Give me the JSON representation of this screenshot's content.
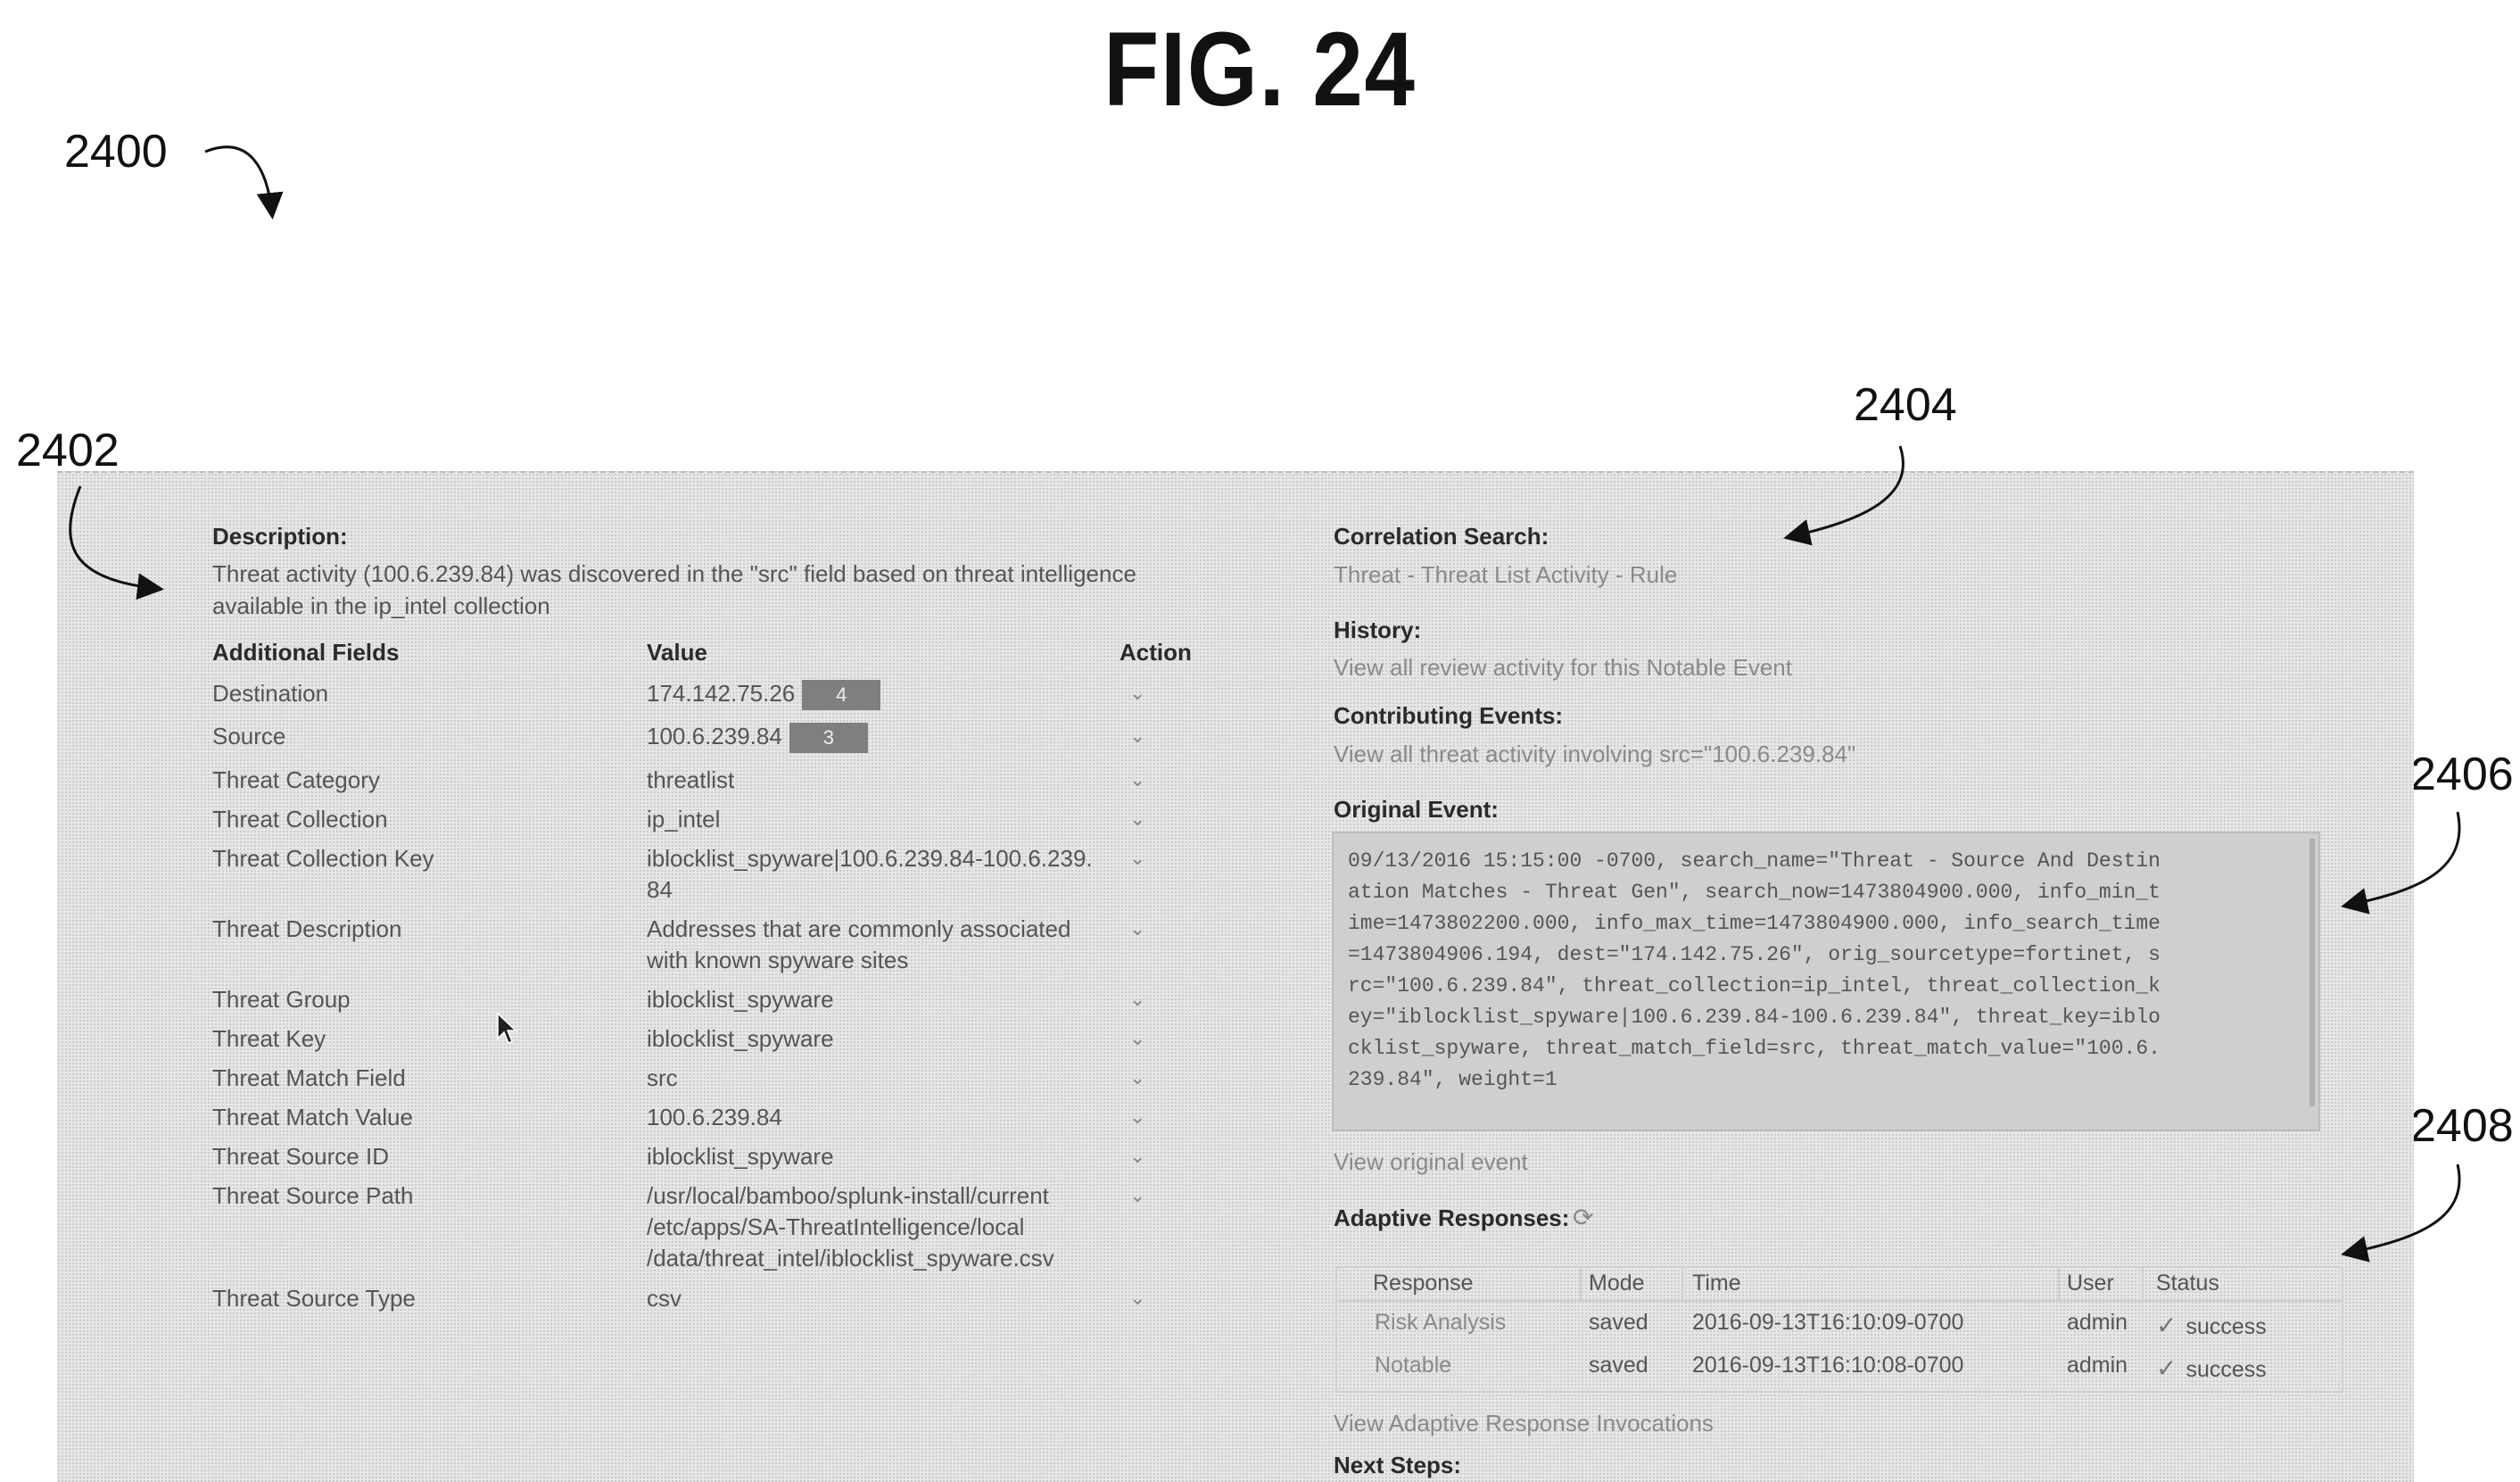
{
  "figure": {
    "title": "FIG. 24",
    "refs": {
      "r2400": "2400",
      "r2402": "2402",
      "r2404": "2404",
      "r2406": "2406",
      "r2408": "2408"
    }
  },
  "left": {
    "description_label": "Description:",
    "description_line1": "Threat activity (100.6.239.84) was discovered in the \"src\" field based on threat intelligence",
    "description_line2": "available in the ip_intel collection",
    "headers": {
      "field": "Additional Fields",
      "value": "Value",
      "action": "Action"
    },
    "rows": [
      {
        "field": "Destination",
        "value": [
          "174.142.75.26"
        ],
        "badge": "4"
      },
      {
        "field": "Source",
        "value": [
          "100.6.239.84"
        ],
        "badge": "3"
      },
      {
        "field": "Threat Category",
        "value": [
          "threatlist"
        ]
      },
      {
        "field": "Threat Collection",
        "value": [
          "ip_intel"
        ]
      },
      {
        "field": "Threat Collection Key",
        "value": [
          "iblocklist_spyware|100.6.239.84-100.6.239.",
          "84"
        ]
      },
      {
        "field": "Threat Description",
        "value": [
          "Addresses that are commonly associated",
          "with known spyware sites"
        ]
      },
      {
        "field": "Threat Group",
        "value": [
          "iblocklist_spyware"
        ]
      },
      {
        "field": "Threat Key",
        "value": [
          "iblocklist_spyware"
        ]
      },
      {
        "field": "Threat Match Field",
        "value": [
          "src"
        ]
      },
      {
        "field": "Threat Match Value",
        "value": [
          "100.6.239.84"
        ]
      },
      {
        "field": "Threat Source ID",
        "value": [
          "iblocklist_spyware"
        ]
      },
      {
        "field": "Threat Source Path",
        "value": [
          "/usr/local/bamboo/splunk-install/current",
          "/etc/apps/SA-ThreatIntelligence/local",
          "/data/threat_intel/iblocklist_spyware.csv"
        ]
      },
      {
        "field": "Threat Source Type",
        "value": [
          "csv"
        ]
      }
    ]
  },
  "right": {
    "correlation_label": "Correlation Search:",
    "correlation_link": "Threat - Threat List Activity - Rule",
    "history_label": "History:",
    "history_link": "View all review activity for this Notable Event",
    "contributing_label": "Contributing Events:",
    "contributing_link": "View all threat activity involving src=\"100.6.239.84\"",
    "original_label": "Original Event:",
    "original_event_lines": [
      "09/13/2016 15:15:00 -0700, search_name=\"Threat - Source And Destin",
      "ation Matches - Threat Gen\", search_now=1473804900.000, info_min_t",
      "ime=1473802200.000, info_max_time=1473804900.000, info_search_time",
      "=1473804906.194, dest=\"174.142.75.26\", orig_sourcetype=fortinet, s",
      "rc=\"100.6.239.84\", threat_collection=ip_intel, threat_collection_k",
      "ey=\"iblocklist_spyware|100.6.239.84-100.6.239.84\", threat_key=iblo",
      "cklist_spyware, threat_match_field=src, threat_match_value=\"100.6.",
      "239.84\", weight=1"
    ],
    "view_original": "View original event",
    "adaptive_label": "Adaptive Responses:",
    "table": {
      "headers": [
        "Response",
        "Mode",
        "Time",
        "User",
        "Status"
      ],
      "rows": [
        [
          "Risk Analysis",
          "saved",
          "2016-09-13T16:10:09-0700",
          "admin",
          "success"
        ],
        [
          "Notable",
          "saved",
          "2016-09-13T16:10:08-0700",
          "admin",
          "success"
        ]
      ]
    },
    "view_invocations": "View Adaptive Response Invocations",
    "next_steps": "Next Steps:"
  }
}
